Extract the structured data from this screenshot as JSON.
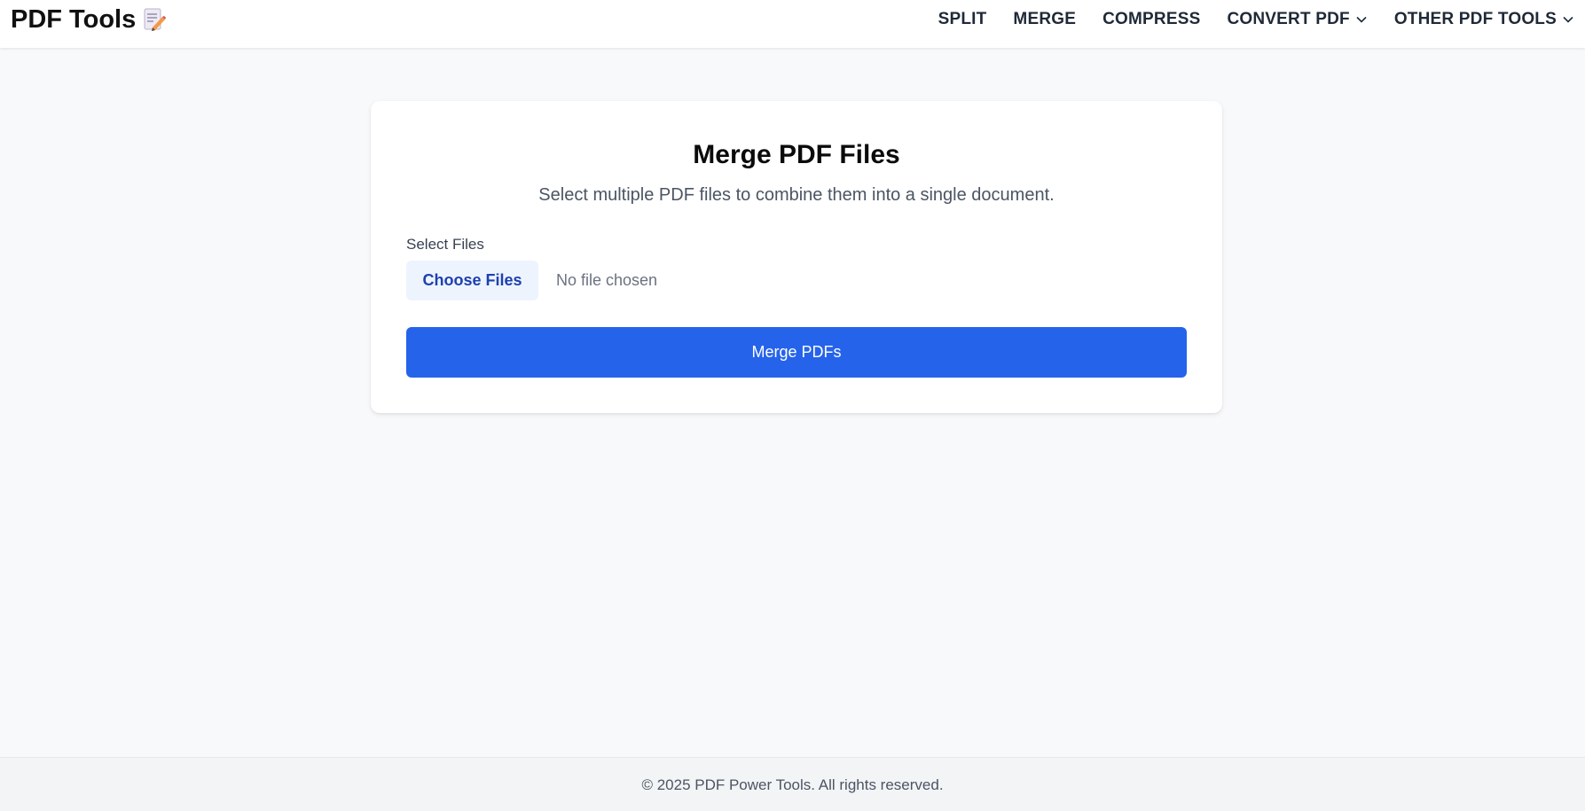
{
  "header": {
    "brand": "PDF Tools",
    "brand_icon": "memo-pencil-icon",
    "nav": [
      {
        "label": "SPLIT"
      },
      {
        "label": "MERGE"
      },
      {
        "label": "COMPRESS"
      },
      {
        "label": "CONVERT PDF",
        "icon": "chevron-down-icon"
      },
      {
        "label": "OTHER PDF TOOLS",
        "icon": "chevron-down-icon"
      }
    ]
  },
  "card": {
    "title": "Merge PDF Files",
    "subtitle": "Select multiple PDF files to combine them into a single document.",
    "field_label": "Select Files",
    "choose_button": "Choose Files",
    "file_status": "No file chosen",
    "submit_button": "Merge PDFs"
  },
  "footer": {
    "text": "© 2025 PDF Power Tools. All rights reserved."
  },
  "colors": {
    "primary": "#2563eb",
    "choose_button_bg": "#eef4fd",
    "choose_button_text": "#1e40af",
    "page_bg": "#f8f9fb",
    "footer_bg": "#f3f4f6"
  }
}
